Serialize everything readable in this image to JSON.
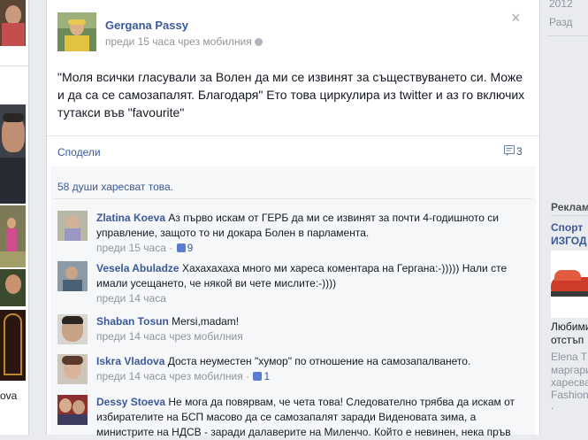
{
  "left_column": {
    "truncated_label": "ova"
  },
  "post": {
    "author": "Gergana Passy",
    "meta": "преди 15 часа чрез мобилния",
    "close_symbol": "×",
    "text": "\"Моля всички гласували за Волен да ми се извинят за съществуването си. Може и да са се самозапалят. Благодаря\" Ето това циркулира из twitter и аз го включих тутакси във \"favourite\"",
    "share_label": "Сподели",
    "comment_count": "3",
    "likes_text": "58 души харесват това."
  },
  "comments": [
    {
      "name": "Zlatina Koeva",
      "text": "Аз първо искам от ГЕРБ да ми се извинят за почти 4-годишното си управление, защото то ни докара Болен в парламента.",
      "time": "преди 15 часа",
      "via": "",
      "likes": "9"
    },
    {
      "name": "Vesela Abuladze",
      "text": "Хахахахаха много ми хареса коментара на Гергана:-))))) Нали сте имали усещането, че някой ви чете мислите:-))))",
      "time": "преди 14 часа",
      "via": "",
      "likes": ""
    },
    {
      "name": "Shaban Tosun",
      "text": "Mersi,madam!",
      "time": "преди 14 часа",
      "via": "чрез мобилния",
      "likes": ""
    },
    {
      "name": "Iskra Vladova",
      "text": "Доста неуместен \"хумор\" по отношение на самозапалването.",
      "time": "преди 14 часа",
      "via": "чрез мобилния",
      "likes": "1"
    },
    {
      "name": "Dessy Stoeva",
      "text": "Не мога да повярвам, че чета това! Следователно трябва да искам от избирателите на БСП масово да се самозапалят заради Виденовата зима, а министрите на НДСВ - заради далаверите на Миленчо. Който е невинен, нека пръв",
      "time": "",
      "via": "",
      "likes": ""
    }
  ],
  "right_column": {
    "year": "2012",
    "tab_label": "Разд",
    "ads_header": "Реклам",
    "ad_title_1": "Спорт",
    "ad_title_2": "ИЗГОД",
    "ad_text_1": "Любими",
    "ad_text_2": "отстъп",
    "ad_person": "Elena T",
    "ad_like_1": "маргари",
    "ad_like_2": "харесва",
    "ad_like_3": "Fashion",
    "ad_dot": "."
  },
  "colors": {
    "link": "#3b5998",
    "meta": "#90949c",
    "page_bg": "#e9ebee"
  }
}
